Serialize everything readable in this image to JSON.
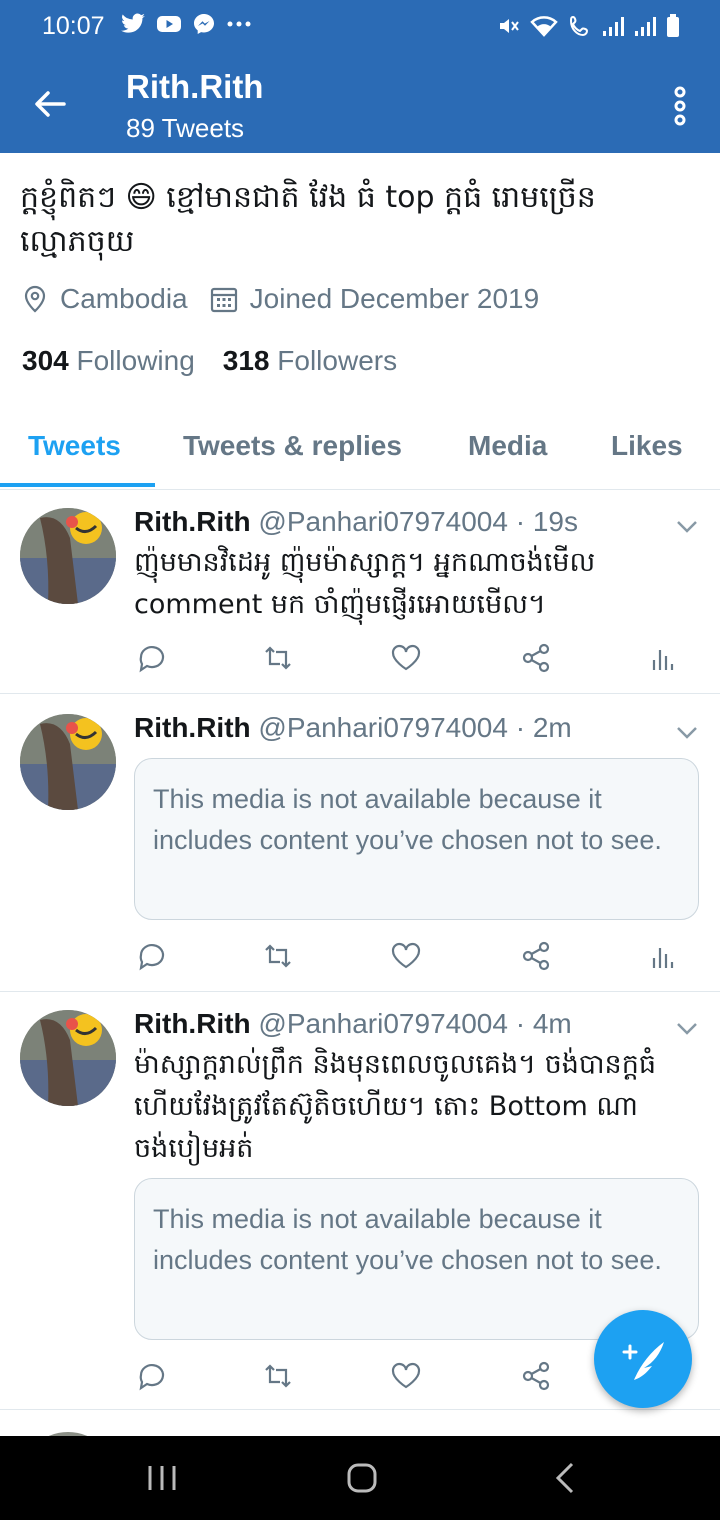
{
  "status_bar": {
    "time": "10:07"
  },
  "header": {
    "name": "Rith.Rith",
    "tweet_count": "89 Tweets"
  },
  "profile": {
    "bio": "ក្ដខ្ញុំពិតៗ 😄 ខ្មៅមានជាតិ វែង ធំ top ក្ដធំ រោមច្រើន ល្មោភចុយ",
    "location": "Cambodia",
    "joined": "Joined December 2019",
    "following_count": "304",
    "following_label": "Following",
    "followers_count": "318",
    "followers_label": "Followers"
  },
  "tabs": [
    "Tweets",
    "Tweets & replies",
    "Media",
    "Likes"
  ],
  "tweets": [
    {
      "name": "Rith.Rith",
      "handle": "@Panhari07974004 · 19s",
      "text": "ញ៉ុមមានវិដេអូ ញ៉ុមម៉ាស្សាក្ដ។ អ្នកណាចង់មើល comment មក ចាំញ៉ុមផ្ញើរអោយមើល។",
      "media_notice": ""
    },
    {
      "name": "Rith.Rith",
      "handle": "@Panhari07974004 · 2m",
      "text": "",
      "media_notice": "This media is not available because it includes content you’ve chosen not to see."
    },
    {
      "name": "Rith.Rith",
      "handle": "@Panhari07974004 · 4m",
      "text": "ម៉ាស្សាក្ដរាល់ព្រឹក និងមុនពេលចូលគេង។ ចង់បានក្ដធំ ហើយវែងត្រូវតែស៊ូតិចហើយ។ តោះ Bottom ណាចង់បៀមអត់",
      "media_notice": "This media is not available because it includes content you’ve chosen not to see."
    }
  ],
  "colors": {
    "header_bg": "#2b6bb5",
    "accent": "#1da1f2",
    "muted": "#657786"
  }
}
